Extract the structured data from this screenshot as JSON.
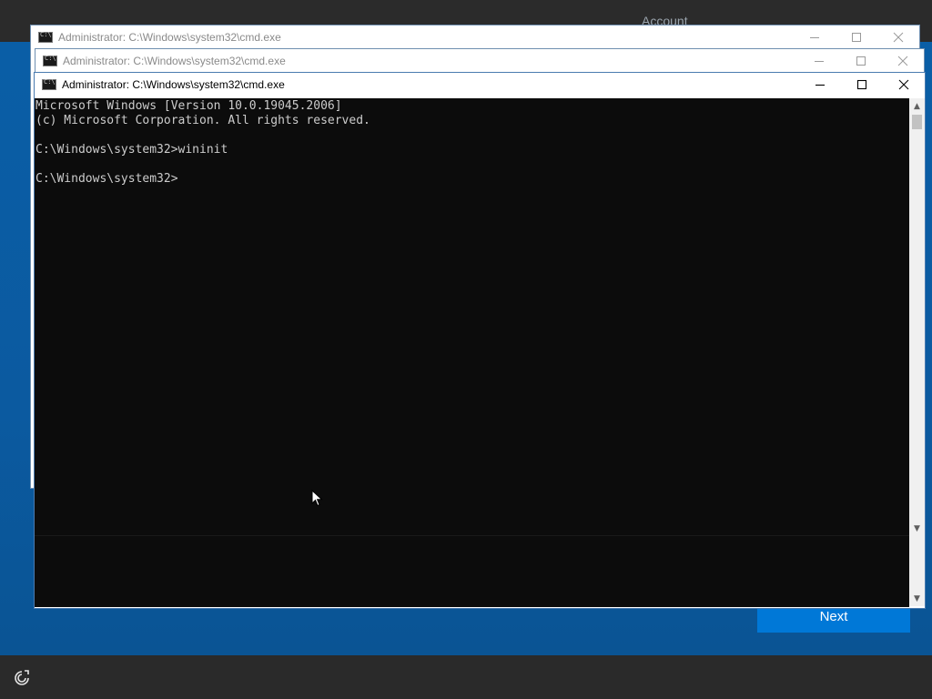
{
  "oobe": {
    "header_text": "Account",
    "next_label": "Next",
    "ease_icon": "ease-of-access-icon"
  },
  "windows": [
    {
      "title": "Administrator: C:\\Windows\\system32\\cmd.exe",
      "state": "inactive"
    },
    {
      "title": "Administrator: C:\\Windows\\system32\\cmd.exe",
      "state": "inactive"
    },
    {
      "title": "Administrator: C:\\Windows\\system32\\cmd.exe",
      "state": "active"
    }
  ],
  "console": {
    "text": "Microsoft Windows [Version 10.0.19045.2006]\n(c) Microsoft Corporation. All rights reserved.\n\nC:\\Windows\\system32>wininit\n\nC:\\Windows\\system32>"
  },
  "colors": {
    "desktop_blue": "#0b5aa0",
    "button_blue": "#0078d7",
    "console_bg": "#0c0c0c",
    "console_fg": "#cccccc"
  }
}
